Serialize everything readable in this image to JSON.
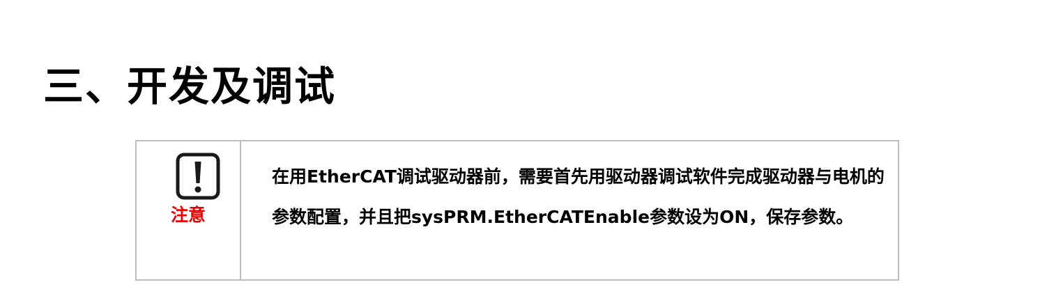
{
  "section": {
    "title": "三、开发及调试"
  },
  "notice": {
    "icon": "exclamation-icon",
    "label": "注意",
    "label_color": "#ee0000",
    "text": "在用EtherCAT调试驱动器前，需要首先用驱动器调试软件完成驱动器与电机的参数配置，并且把sysPRM.EtherCATEnable参数设为ON，保存参数。"
  }
}
